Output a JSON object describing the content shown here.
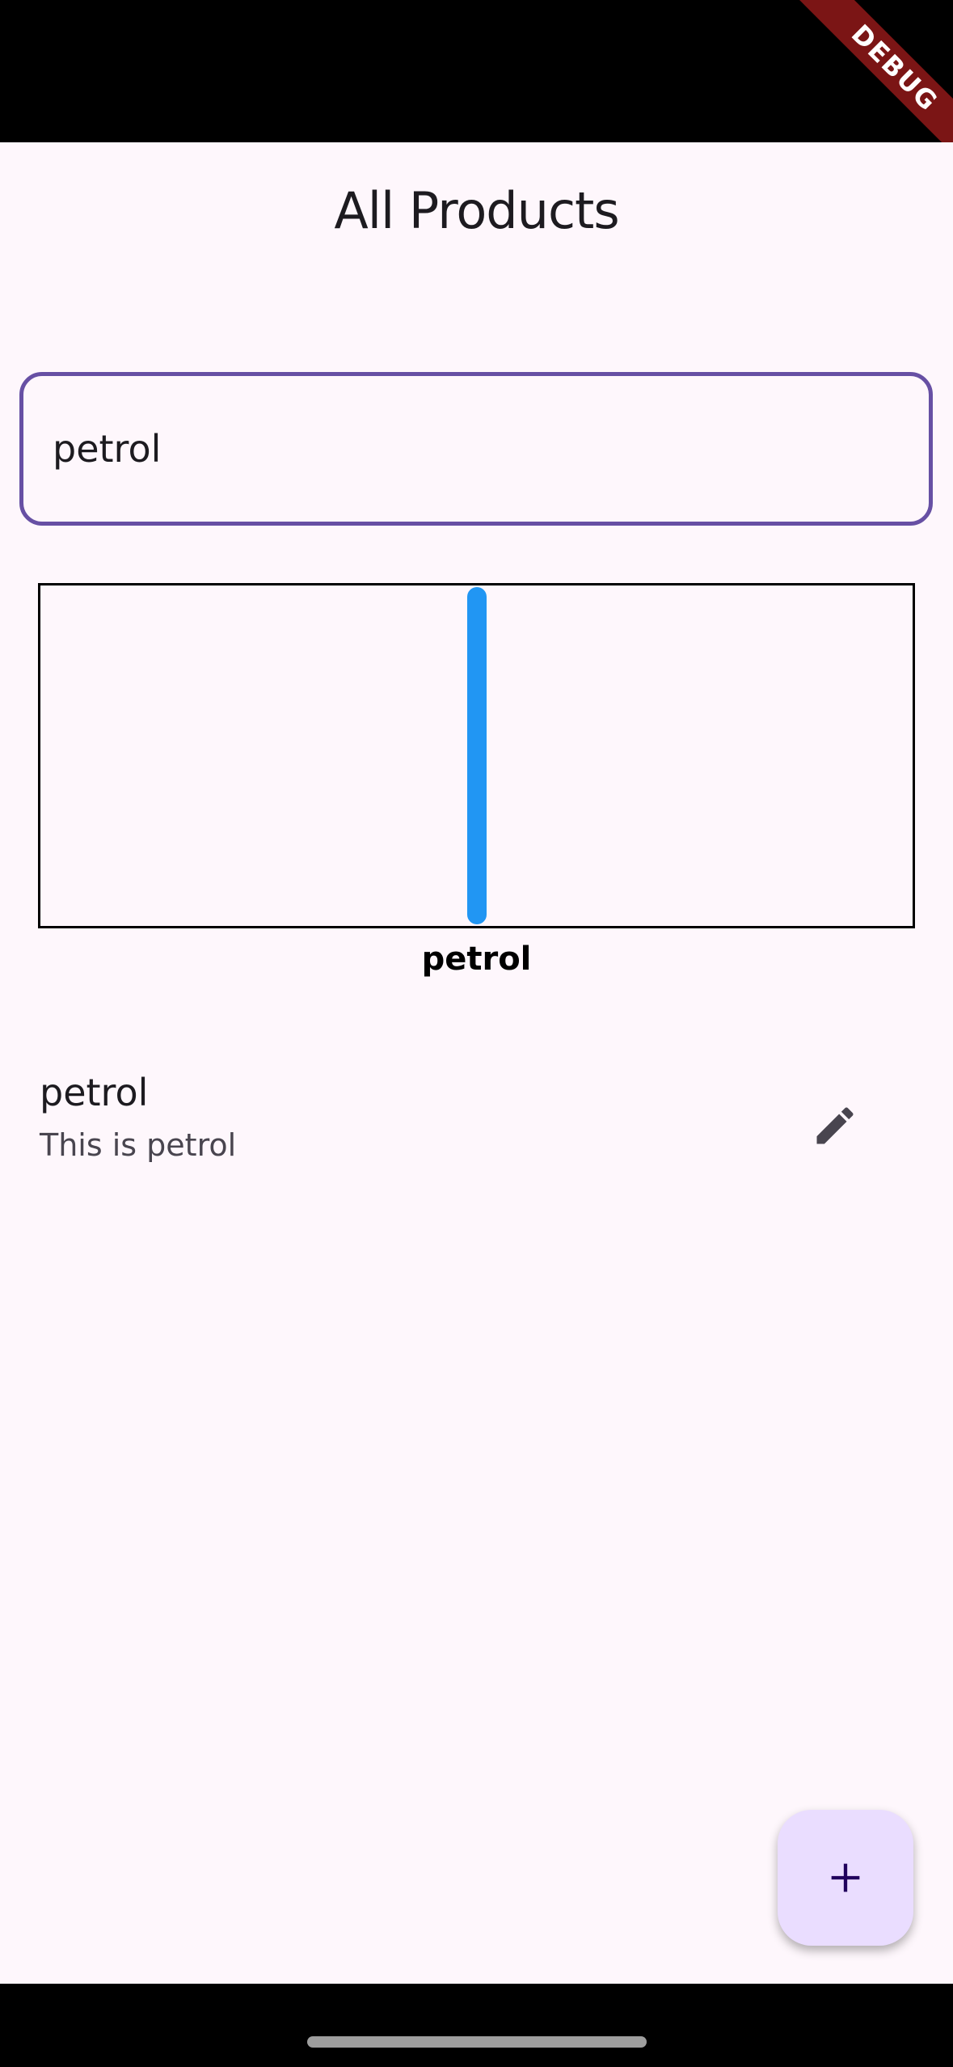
{
  "status_bar": {
    "debug_label": "DEBUG"
  },
  "app_bar": {
    "title": "All Products"
  },
  "search": {
    "value": "petrol",
    "border_color": "#6750a4"
  },
  "chart_data": {
    "type": "bar",
    "categories": [
      "petrol"
    ],
    "values": [
      1
    ],
    "ylim": [
      0,
      1
    ],
    "bar_color": "#2196f3",
    "grid": false
  },
  "products": [
    {
      "name": "petrol",
      "description": "This is petrol",
      "action_icon": "edit-icon"
    }
  ],
  "fab": {
    "icon": "add-icon",
    "color": "#eaddff"
  }
}
